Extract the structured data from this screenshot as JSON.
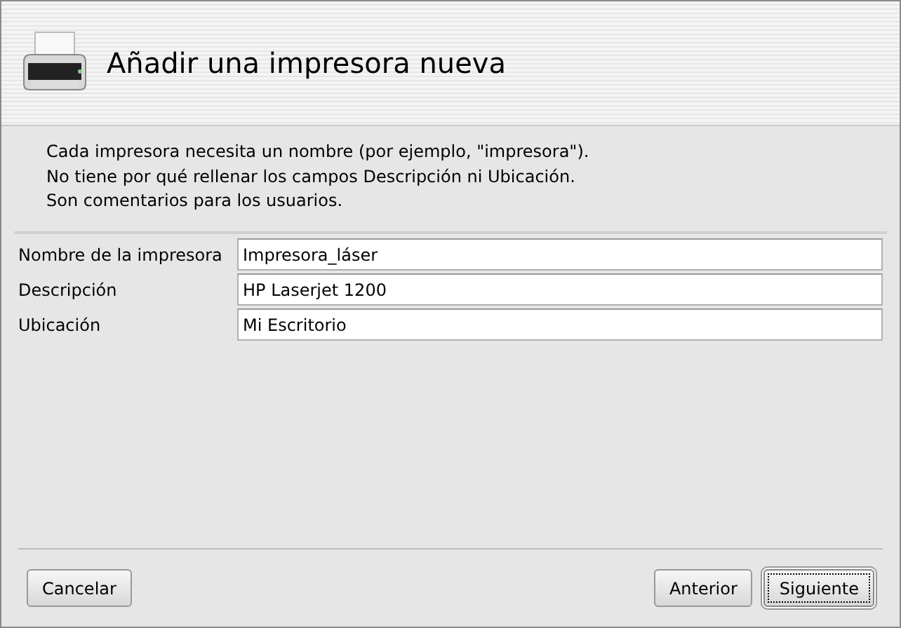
{
  "header": {
    "title": "Añadir una impresora nueva"
  },
  "intro": [
    "Cada impresora necesita un nombre (por ejemplo, \"impresora\").",
    "No tiene por qué rellenar los campos Descripción ni Ubicación.",
    "Son comentarios para los usuarios."
  ],
  "fields": [
    {
      "label": "Nombre de la impresora",
      "value": "Impresora_láser"
    },
    {
      "label": "Descripción",
      "value": "HP Laserjet 1200"
    },
    {
      "label": "Ubicación",
      "value": "Mi Escritorio"
    }
  ],
  "buttons": [
    {
      "label": "Cancelar",
      "default": false
    },
    {
      "label": "Anterior",
      "default": false
    },
    {
      "label": "Siguiente",
      "default": true
    }
  ]
}
